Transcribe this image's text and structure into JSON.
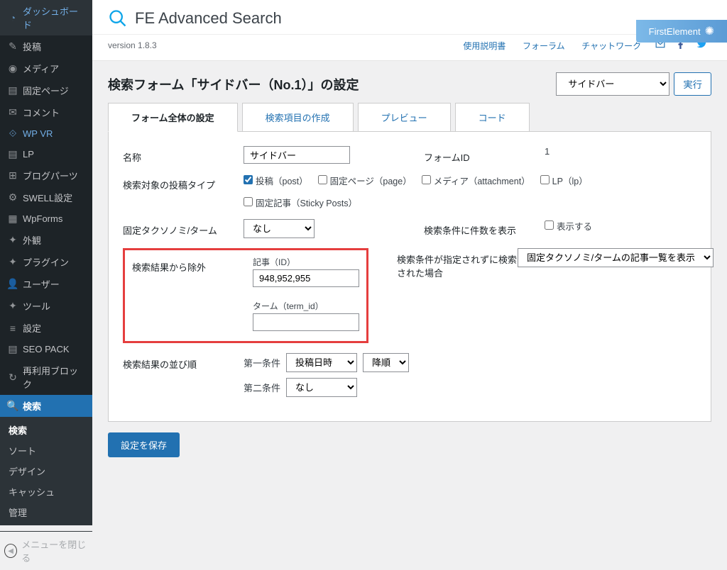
{
  "sidebar": {
    "items": [
      {
        "icon": "◔",
        "label": "ダッシュボード"
      },
      {
        "icon": "✎",
        "label": "投稿"
      },
      {
        "icon": "◉",
        "label": "メディア"
      },
      {
        "icon": "▤",
        "label": "固定ページ"
      },
      {
        "icon": "✉",
        "label": "コメント"
      },
      {
        "icon": "⟐",
        "label": "WP VR",
        "accent": true
      },
      {
        "icon": "▤",
        "label": "LP"
      },
      {
        "icon": "⊞",
        "label": "ブログパーツ"
      },
      {
        "icon": "⚙",
        "label": "SWELL設定"
      },
      {
        "icon": "▦",
        "label": "WpForms"
      },
      {
        "icon": "✦",
        "label": "外観"
      },
      {
        "icon": "✦",
        "label": "プラグイン"
      },
      {
        "icon": "👤",
        "label": "ユーザー"
      },
      {
        "icon": "✦",
        "label": "ツール"
      },
      {
        "icon": "≡",
        "label": "設定"
      },
      {
        "icon": "▤",
        "label": "SEO PACK"
      },
      {
        "icon": "↻",
        "label": "再利用ブロック"
      },
      {
        "icon": "🔍",
        "label": "検索",
        "current": true
      }
    ],
    "sub": [
      "検索",
      "ソート",
      "デザイン",
      "キャッシュ",
      "管理"
    ],
    "collapse": "メニューを閉じる"
  },
  "header": {
    "appTitle": "FE Advanced Search",
    "version": "version 1.8.3",
    "links": [
      "使用説明書",
      "フォーラム",
      "チャットワーク"
    ],
    "brand": "FirstElement"
  },
  "config": {
    "heading": "検索フォーム「サイドバー（No.1）」の設定",
    "formSelect": "サイドバー",
    "execBtn": "実行"
  },
  "tabs": [
    "フォーム全体の設定",
    "検索項目の作成",
    "プレビュー",
    "コード"
  ],
  "form": {
    "name": {
      "label": "名称",
      "value": "サイドバー"
    },
    "formId": {
      "label": "フォームID",
      "value": "1"
    },
    "postType": {
      "label": "検索対象の投稿タイプ",
      "options": [
        {
          "label": "投稿（post）",
          "checked": true
        },
        {
          "label": "固定ページ（page）",
          "checked": false
        },
        {
          "label": "メディア（attachment）",
          "checked": false
        },
        {
          "label": "LP（lp）",
          "checked": false
        },
        {
          "label": "固定記事（Sticky Posts）",
          "checked": false
        }
      ]
    },
    "fixedTax": {
      "label": "固定タクソノミ/ターム",
      "value": "なし"
    },
    "showCount": {
      "label": "検索条件に件数を表示",
      "checkbox": "表示する"
    },
    "exclude": {
      "section": "検索結果から除外",
      "idLabel": "記事（ID）",
      "idValue": "948,952,955",
      "termLabel": "ターム（term_id）",
      "termValue": ""
    },
    "noCond": {
      "label": "検索条件が指定されずに検索された場合",
      "value": "固定タクソノミ/タームの記事一覧を表示"
    },
    "sort": {
      "label": "検索結果の並び順",
      "first": "第一条件",
      "firstVal": "投稿日時",
      "firstOrder": "降順",
      "second": "第二条件",
      "secondVal": "なし"
    }
  },
  "saveBtn": "設定を保存"
}
